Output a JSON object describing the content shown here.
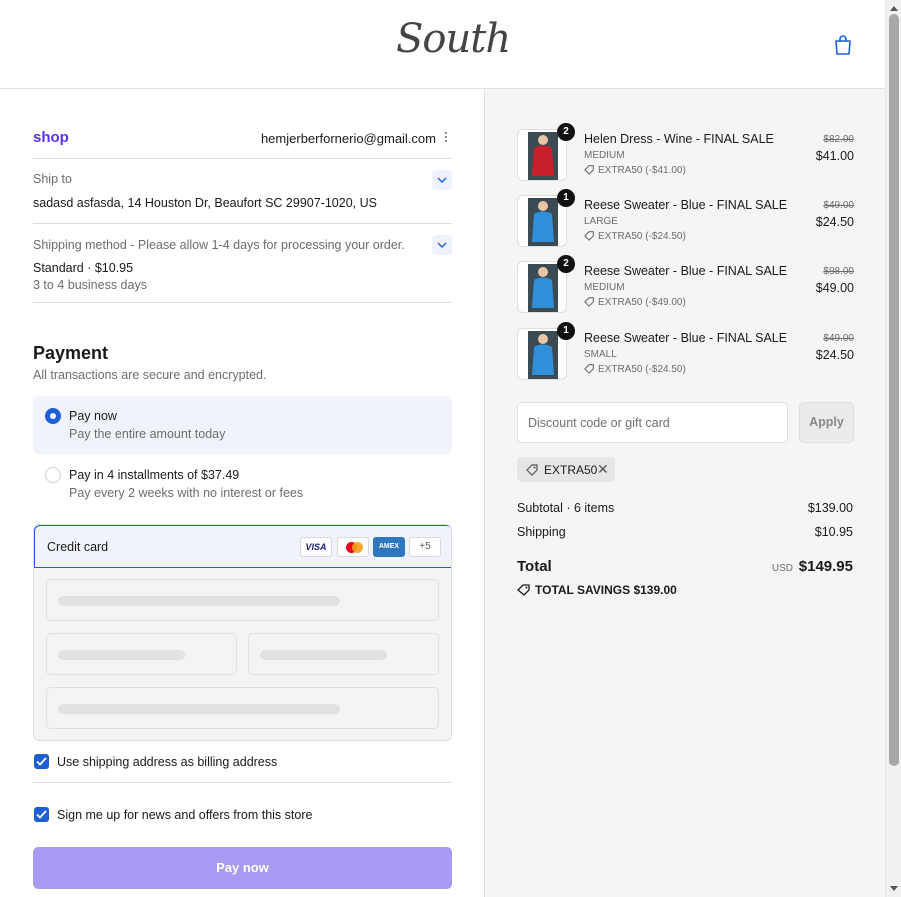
{
  "header": {
    "brand": "South"
  },
  "account": {
    "provider": "shop",
    "email": "hemjerberfornerio@gmail.com"
  },
  "ship_to": {
    "label": "Ship to",
    "address": "sadasd asfasda, 14 Houston Dr, Beaufort SC 29907-1020, US"
  },
  "shipping_method": {
    "label": "Shipping method - Please allow 1-4 days for processing your order.",
    "name": "Standard · $10.95",
    "eta": "3 to 4 business days"
  },
  "payment": {
    "title": "Payment",
    "subtitle": "All transactions are secure and encrypted.",
    "options": [
      {
        "title": "Pay now",
        "subtitle": "Pay the entire amount today",
        "selected": true
      },
      {
        "title": "Pay in 4 installments of $37.49",
        "subtitle": "Pay every 2 weeks with no interest or fees",
        "selected": false
      }
    ],
    "method": "Credit card",
    "cards": {
      "visa": "VISA",
      "amex": "AMEX",
      "more": "+5"
    }
  },
  "checkboxes": {
    "billing": "Use shipping address as billing address",
    "newsletter": "Sign me up for news and offers from this store"
  },
  "pay_button": "Pay now",
  "items": [
    {
      "qty": "2",
      "name": "Helen Dress - Wine - FINAL SALE",
      "variant": "MEDIUM",
      "discount": "EXTRA50 (-$41.00)",
      "old_price": "$82.00",
      "price": "$41.00",
      "color": "#c8202a"
    },
    {
      "qty": "1",
      "name": "Reese Sweater - Blue - FINAL SALE",
      "variant": "LARGE",
      "discount": "EXTRA50 (-$24.50)",
      "old_price": "$49.00",
      "price": "$24.50",
      "color": "#2f8fd8"
    },
    {
      "qty": "2",
      "name": "Reese Sweater - Blue - FINAL SALE",
      "variant": "MEDIUM",
      "discount": "EXTRA50 (-$49.00)",
      "old_price": "$98.00",
      "price": "$49.00",
      "color": "#2f8fd8"
    },
    {
      "qty": "1",
      "name": "Reese Sweater - Blue - FINAL SALE",
      "variant": "SMALL",
      "discount": "EXTRA50 (-$24.50)",
      "old_price": "$49.00",
      "price": "$24.50",
      "color": "#2f8fd8"
    }
  ],
  "discount": {
    "placeholder": "Discount code or gift card",
    "apply": "Apply",
    "applied_code": "EXTRA50"
  },
  "summary": {
    "subtotal_label": "Subtotal · 6 items",
    "subtotal": "$139.00",
    "shipping_label": "Shipping",
    "shipping": "$10.95",
    "total_label": "Total",
    "currency": "USD",
    "total": "$149.95",
    "savings": "TOTAL SAVINGS  $139.00"
  },
  "colors": {
    "accent": "#1f5fd4",
    "shop_purple": "#5a31f4",
    "pay_button": "#a99bf5"
  }
}
